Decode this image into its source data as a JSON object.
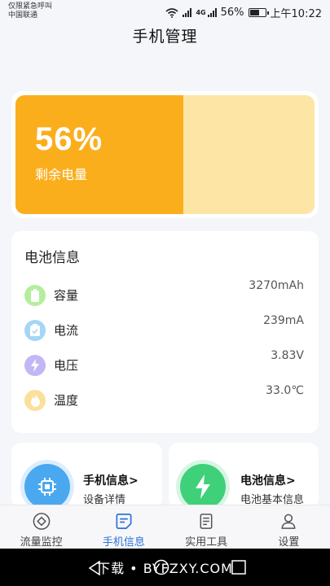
{
  "status_bar": {
    "line1": "仅限紧急呼叫",
    "line2": "中国联通",
    "network": "4G",
    "battery_percent": "56%",
    "time": "上午10:22"
  },
  "page": {
    "title": "手机管理"
  },
  "battery_hero": {
    "percent_text": "56%",
    "level": 0.56,
    "label": "剩余电量",
    "fill_color": "#fbae1c",
    "track_color": "#fde5a6"
  },
  "battery_info": {
    "title": "电池信息",
    "rows": [
      {
        "label": "容量",
        "value": "3270mAh",
        "icon": "battery-icon",
        "color": "#b4ee9c"
      },
      {
        "label": "电流",
        "value": "239mA",
        "icon": "clipboard-check-icon",
        "color": "#a3d6f7"
      },
      {
        "label": "电压",
        "value": "3.83V",
        "icon": "bolt-icon",
        "color": "#c3b6f5"
      },
      {
        "label": "温度",
        "value": "33.0℃",
        "icon": "flame-icon",
        "color": "#fcdf9a"
      }
    ]
  },
  "features": [
    {
      "title": "手机信息>",
      "subtitle": "设备详情",
      "icon": "chip-icon",
      "color": "#4aa8f0"
    },
    {
      "title": "电池信息>",
      "subtitle": "电池基本信息",
      "icon": "bolt-icon",
      "color": "#3fd07a"
    }
  ],
  "bottom_nav": {
    "items": [
      {
        "label": "流量监控",
        "icon": "target-icon",
        "active": false
      },
      {
        "label": "手机信息",
        "icon": "note-icon",
        "active": true
      },
      {
        "label": "实用工具",
        "icon": "document-icon",
        "active": false
      },
      {
        "label": "设置",
        "icon": "user-icon",
        "active": false
      }
    ],
    "active_color": "#2a74d9"
  },
  "system_bar": {
    "watermark": "下载 • BYFZXY.COM"
  }
}
